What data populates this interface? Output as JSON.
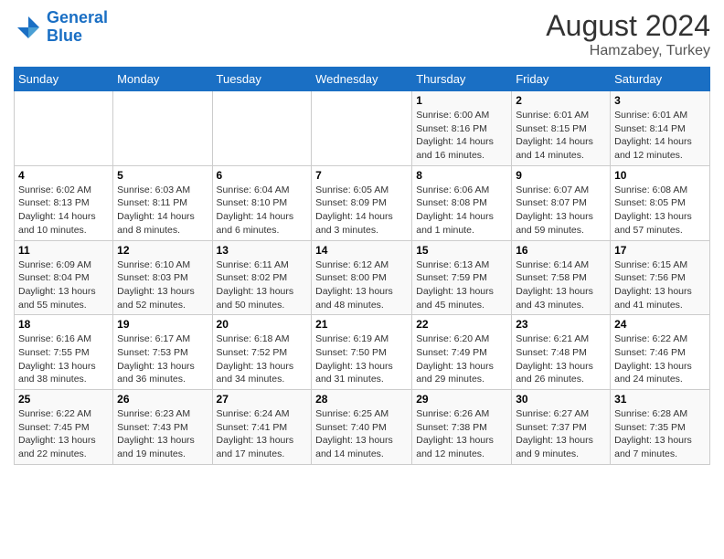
{
  "header": {
    "logo_line1": "General",
    "logo_line2": "Blue",
    "month_year": "August 2024",
    "location": "Hamzabey, Turkey"
  },
  "weekdays": [
    "Sunday",
    "Monday",
    "Tuesday",
    "Wednesday",
    "Thursday",
    "Friday",
    "Saturday"
  ],
  "weeks": [
    [
      {
        "day": "",
        "sunrise": "",
        "sunset": "",
        "daylight": ""
      },
      {
        "day": "",
        "sunrise": "",
        "sunset": "",
        "daylight": ""
      },
      {
        "day": "",
        "sunrise": "",
        "sunset": "",
        "daylight": ""
      },
      {
        "day": "",
        "sunrise": "",
        "sunset": "",
        "daylight": ""
      },
      {
        "day": "1",
        "sunrise": "Sunrise: 6:00 AM",
        "sunset": "Sunset: 8:16 PM",
        "daylight": "Daylight: 14 hours and 16 minutes."
      },
      {
        "day": "2",
        "sunrise": "Sunrise: 6:01 AM",
        "sunset": "Sunset: 8:15 PM",
        "daylight": "Daylight: 14 hours and 14 minutes."
      },
      {
        "day": "3",
        "sunrise": "Sunrise: 6:01 AM",
        "sunset": "Sunset: 8:14 PM",
        "daylight": "Daylight: 14 hours and 12 minutes."
      }
    ],
    [
      {
        "day": "4",
        "sunrise": "Sunrise: 6:02 AM",
        "sunset": "Sunset: 8:13 PM",
        "daylight": "Daylight: 14 hours and 10 minutes."
      },
      {
        "day": "5",
        "sunrise": "Sunrise: 6:03 AM",
        "sunset": "Sunset: 8:11 PM",
        "daylight": "Daylight: 14 hours and 8 minutes."
      },
      {
        "day": "6",
        "sunrise": "Sunrise: 6:04 AM",
        "sunset": "Sunset: 8:10 PM",
        "daylight": "Daylight: 14 hours and 6 minutes."
      },
      {
        "day": "7",
        "sunrise": "Sunrise: 6:05 AM",
        "sunset": "Sunset: 8:09 PM",
        "daylight": "Daylight: 14 hours and 3 minutes."
      },
      {
        "day": "8",
        "sunrise": "Sunrise: 6:06 AM",
        "sunset": "Sunset: 8:08 PM",
        "daylight": "Daylight: 14 hours and 1 minute."
      },
      {
        "day": "9",
        "sunrise": "Sunrise: 6:07 AM",
        "sunset": "Sunset: 8:07 PM",
        "daylight": "Daylight: 13 hours and 59 minutes."
      },
      {
        "day": "10",
        "sunrise": "Sunrise: 6:08 AM",
        "sunset": "Sunset: 8:05 PM",
        "daylight": "Daylight: 13 hours and 57 minutes."
      }
    ],
    [
      {
        "day": "11",
        "sunrise": "Sunrise: 6:09 AM",
        "sunset": "Sunset: 8:04 PM",
        "daylight": "Daylight: 13 hours and 55 minutes."
      },
      {
        "day": "12",
        "sunrise": "Sunrise: 6:10 AM",
        "sunset": "Sunset: 8:03 PM",
        "daylight": "Daylight: 13 hours and 52 minutes."
      },
      {
        "day": "13",
        "sunrise": "Sunrise: 6:11 AM",
        "sunset": "Sunset: 8:02 PM",
        "daylight": "Daylight: 13 hours and 50 minutes."
      },
      {
        "day": "14",
        "sunrise": "Sunrise: 6:12 AM",
        "sunset": "Sunset: 8:00 PM",
        "daylight": "Daylight: 13 hours and 48 minutes."
      },
      {
        "day": "15",
        "sunrise": "Sunrise: 6:13 AM",
        "sunset": "Sunset: 7:59 PM",
        "daylight": "Daylight: 13 hours and 45 minutes."
      },
      {
        "day": "16",
        "sunrise": "Sunrise: 6:14 AM",
        "sunset": "Sunset: 7:58 PM",
        "daylight": "Daylight: 13 hours and 43 minutes."
      },
      {
        "day": "17",
        "sunrise": "Sunrise: 6:15 AM",
        "sunset": "Sunset: 7:56 PM",
        "daylight": "Daylight: 13 hours and 41 minutes."
      }
    ],
    [
      {
        "day": "18",
        "sunrise": "Sunrise: 6:16 AM",
        "sunset": "Sunset: 7:55 PM",
        "daylight": "Daylight: 13 hours and 38 minutes."
      },
      {
        "day": "19",
        "sunrise": "Sunrise: 6:17 AM",
        "sunset": "Sunset: 7:53 PM",
        "daylight": "Daylight: 13 hours and 36 minutes."
      },
      {
        "day": "20",
        "sunrise": "Sunrise: 6:18 AM",
        "sunset": "Sunset: 7:52 PM",
        "daylight": "Daylight: 13 hours and 34 minutes."
      },
      {
        "day": "21",
        "sunrise": "Sunrise: 6:19 AM",
        "sunset": "Sunset: 7:50 PM",
        "daylight": "Daylight: 13 hours and 31 minutes."
      },
      {
        "day": "22",
        "sunrise": "Sunrise: 6:20 AM",
        "sunset": "Sunset: 7:49 PM",
        "daylight": "Daylight: 13 hours and 29 minutes."
      },
      {
        "day": "23",
        "sunrise": "Sunrise: 6:21 AM",
        "sunset": "Sunset: 7:48 PM",
        "daylight": "Daylight: 13 hours and 26 minutes."
      },
      {
        "day": "24",
        "sunrise": "Sunrise: 6:22 AM",
        "sunset": "Sunset: 7:46 PM",
        "daylight": "Daylight: 13 hours and 24 minutes."
      }
    ],
    [
      {
        "day": "25",
        "sunrise": "Sunrise: 6:22 AM",
        "sunset": "Sunset: 7:45 PM",
        "daylight": "Daylight: 13 hours and 22 minutes."
      },
      {
        "day": "26",
        "sunrise": "Sunrise: 6:23 AM",
        "sunset": "Sunset: 7:43 PM",
        "daylight": "Daylight: 13 hours and 19 minutes."
      },
      {
        "day": "27",
        "sunrise": "Sunrise: 6:24 AM",
        "sunset": "Sunset: 7:41 PM",
        "daylight": "Daylight: 13 hours and 17 minutes."
      },
      {
        "day": "28",
        "sunrise": "Sunrise: 6:25 AM",
        "sunset": "Sunset: 7:40 PM",
        "daylight": "Daylight: 13 hours and 14 minutes."
      },
      {
        "day": "29",
        "sunrise": "Sunrise: 6:26 AM",
        "sunset": "Sunset: 7:38 PM",
        "daylight": "Daylight: 13 hours and 12 minutes."
      },
      {
        "day": "30",
        "sunrise": "Sunrise: 6:27 AM",
        "sunset": "Sunset: 7:37 PM",
        "daylight": "Daylight: 13 hours and 9 minutes."
      },
      {
        "day": "31",
        "sunrise": "Sunrise: 6:28 AM",
        "sunset": "Sunset: 7:35 PM",
        "daylight": "Daylight: 13 hours and 7 minutes."
      }
    ]
  ]
}
